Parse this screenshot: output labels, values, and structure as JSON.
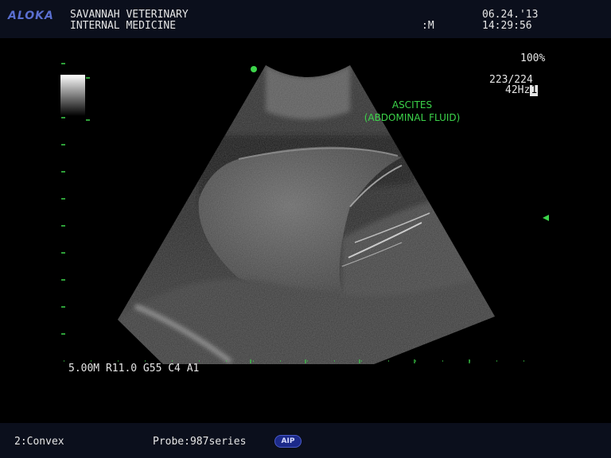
{
  "header": {
    "brand": "ALOKA",
    "clinic_line1": "SAVANNAH VETERINARY",
    "clinic_line2": "INTERNAL MEDICINE",
    "mode_marker": ":M",
    "date": "06.24.'13",
    "time": "14:29:56"
  },
  "display": {
    "zoom": "100%",
    "frame_count": "223/224",
    "frame_rate": "42Hz",
    "frame_rate_suffix": "1"
  },
  "annotation": {
    "line1": "ASCITES",
    "line2": "(ABDOMINAL FLUID)"
  },
  "parameters": "5.00M R11.0 G55 C4 A1",
  "footer": {
    "transducer": "2:Convex",
    "probe": "Probe:987series",
    "badge": "AIP"
  },
  "colors": {
    "overlay_green": "#3cd44a",
    "brand_blue": "#5a6fd0",
    "bar_background": "#0b0f1c"
  }
}
